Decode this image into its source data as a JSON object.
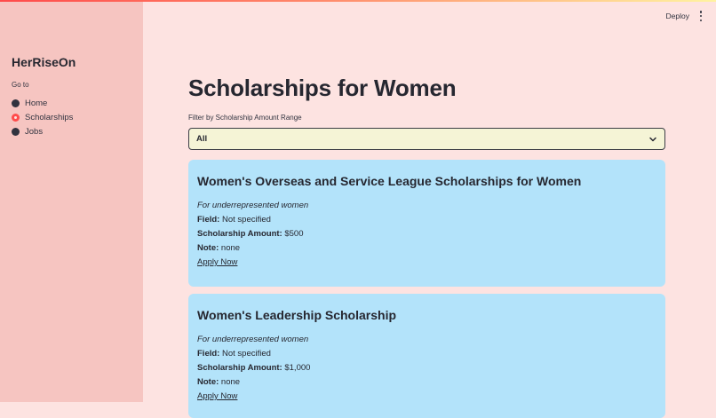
{
  "app": {
    "title": "HerRiseOn"
  },
  "sidebar": {
    "nav_label": "Go to",
    "items": [
      {
        "label": "Home",
        "selected": false
      },
      {
        "label": "Scholarships",
        "selected": true
      },
      {
        "label": "Jobs",
        "selected": false
      }
    ]
  },
  "header": {
    "deploy_label": "Deploy",
    "menu_icon": "kebab-menu-icon"
  },
  "main": {
    "title": "Scholarships for Women",
    "filter": {
      "label": "Filter by Scholarship Amount Range",
      "selected": "All"
    },
    "cards": [
      {
        "title": "Women's Overseas and Service League Scholarships for Women",
        "subtitle": "For underrepresented women",
        "field_label": "Field:",
        "field_value": "Not specified",
        "amount_label": "Scholarship Amount:",
        "amount_value": "$500",
        "note_label": "Note:",
        "note_value": "none",
        "link_label": "Apply Now"
      },
      {
        "title": "Women's Leadership Scholarship",
        "subtitle": "For underrepresented women",
        "field_label": "Field:",
        "field_value": "Not specified",
        "amount_label": "Scholarship Amount:",
        "amount_value": "$1,000",
        "note_label": "Note:",
        "note_value": "none",
        "link_label": "Apply Now"
      }
    ]
  },
  "colors": {
    "background": "#fde3e1",
    "sidebar": "#f6c5c1",
    "card": "#b3e3fa",
    "select": "#f5f4d6",
    "accent": "#ff4b4b"
  }
}
